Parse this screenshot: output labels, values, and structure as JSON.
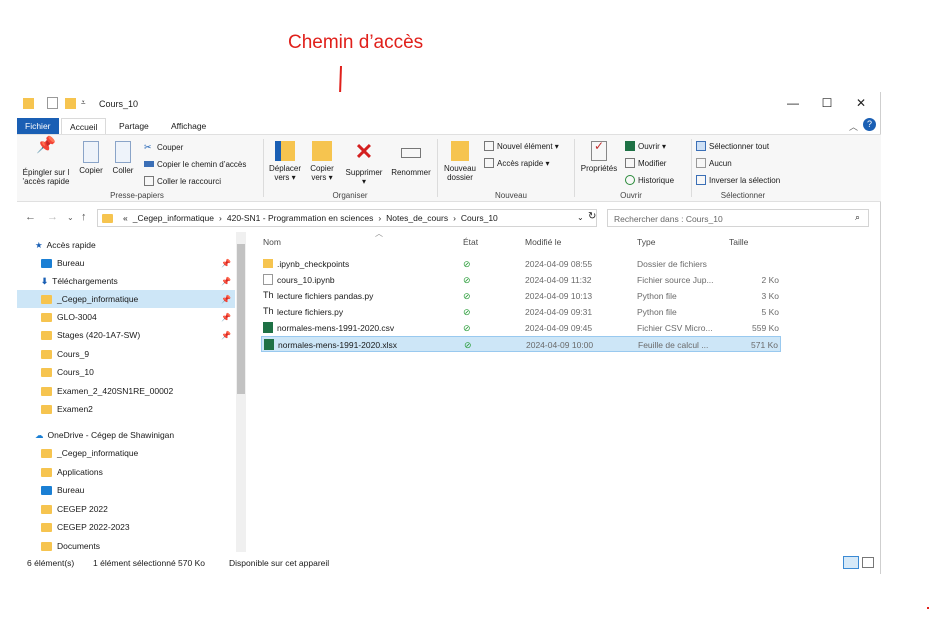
{
  "annotation": {
    "label": "Chemin d’accès",
    "color": "#e0201b"
  },
  "window": {
    "title": "Cours_10",
    "tabs": [
      "Fichier",
      "Accueil",
      "Partage",
      "Affichage"
    ]
  },
  "ribbon": {
    "presse_papiers": {
      "label": "Presse-papiers",
      "pin_label": "Épingler sur l 'accès rapide",
      "copy": "Copier",
      "paste": "Coller",
      "cut": "Couper",
      "copy_path": "Copier le chemin d’accès",
      "paste_shortcut": "Coller le raccourci"
    },
    "organiser": {
      "label": "Organiser",
      "move_to": "Déplacer vers ▾",
      "copy_to": "Copier vers ▾",
      "delete": "Supprimer ▾",
      "rename": "Renommer"
    },
    "nouveau": {
      "label": "Nouveau",
      "new_folder": "Nouveau dossier",
      "new_item": "Nouvel élément ▾",
      "quick_access": "Accès rapide ▾"
    },
    "ouvrir": {
      "label": "Ouvrir",
      "properties": "Propriétés",
      "open": "Ouvrir ▾",
      "edit": "Modifier",
      "history": "Historique"
    },
    "selectionner": {
      "label": "Sélectionner",
      "select_all": "Sélectionner tout",
      "select_none": "Aucun",
      "invert": "Inverser la sélection"
    }
  },
  "address": {
    "prefix": "«",
    "crumbs": [
      "_Cegep_informatique",
      "420-SN1 - Programmation en sciences",
      "Notes_de_cours",
      "Cours_10"
    ],
    "search_placeholder": "Rechercher dans : Cours_10"
  },
  "sidebar": {
    "quick_access": "Accès rapide",
    "items": [
      {
        "label": "Bureau",
        "pinned": true,
        "icon": "desktop-icon"
      },
      {
        "label": "Téléchargements",
        "pinned": true,
        "icon": "download-icon"
      },
      {
        "label": "_Cegep_informatique",
        "pinned": true,
        "icon": "folder-icon",
        "selected": true
      },
      {
        "label": "GLO-3004",
        "pinned": true,
        "icon": "folder-icon"
      },
      {
        "label": "Stages (420-1A7-SW)",
        "pinned": true,
        "icon": "folder-icon"
      },
      {
        "label": "Cours_9",
        "pinned": false,
        "icon": "folder-icon"
      },
      {
        "label": "Cours_10",
        "pinned": false,
        "icon": "folder-icon"
      },
      {
        "label": "Examen_2_420SN1RE_00002",
        "pinned": false,
        "icon": "folder-icon"
      },
      {
        "label": "Examen2",
        "pinned": false,
        "icon": "folder-icon"
      }
    ],
    "onedrive": "OneDrive - Cégep de Shawinigan",
    "onedrive_items": [
      {
        "label": "_Cegep_informatique",
        "icon": "folder-icon"
      },
      {
        "label": "Applications",
        "icon": "folder-icon"
      },
      {
        "label": "Bureau",
        "icon": "desktop-icon"
      },
      {
        "label": "CEGEP 2022",
        "icon": "folder-icon"
      },
      {
        "label": "CEGEP 2022-2023",
        "icon": "folder-icon"
      },
      {
        "label": "Documents",
        "icon": "folder-icon"
      }
    ]
  },
  "columns": [
    "Nom",
    "État",
    "Modifié le",
    "Type",
    "Taille"
  ],
  "files": [
    {
      "name": ".ipynb_checkpoints",
      "date": "2024-04-09 08:55",
      "type": "Dossier de fichiers",
      "size": "",
      "icon": "folder-icon"
    },
    {
      "name": "cours_10.ipynb",
      "date": "2024-04-09 11:32",
      "type": "Fichier source Jup...",
      "size": "2 Ko",
      "icon": "file-icon"
    },
    {
      "name": "lecture fichiers pandas.py",
      "date": "2024-04-09 10:13",
      "type": "Python file",
      "size": "3 Ko",
      "icon": "python-file-icon"
    },
    {
      "name": "lecture fichiers.py",
      "date": "2024-04-09 09:31",
      "type": "Python file",
      "size": "5 Ko",
      "icon": "python-file-icon"
    },
    {
      "name": "normales-mens-1991-2020.csv",
      "date": "2024-04-09 09:45",
      "type": "Fichier CSV Micro...",
      "size": "559 Ko",
      "icon": "excel-icon"
    },
    {
      "name": "normales-mens-1991-2020.xlsx",
      "date": "2024-04-09 10:00",
      "type": "Feuille de calcul ...",
      "size": "571 Ko",
      "icon": "excel-icon",
      "selected": true
    }
  ],
  "status": {
    "count": "6 élément(s)",
    "selected": "1 élément sélectionné  570 Ko",
    "availability": "Disponible sur cet appareil"
  }
}
